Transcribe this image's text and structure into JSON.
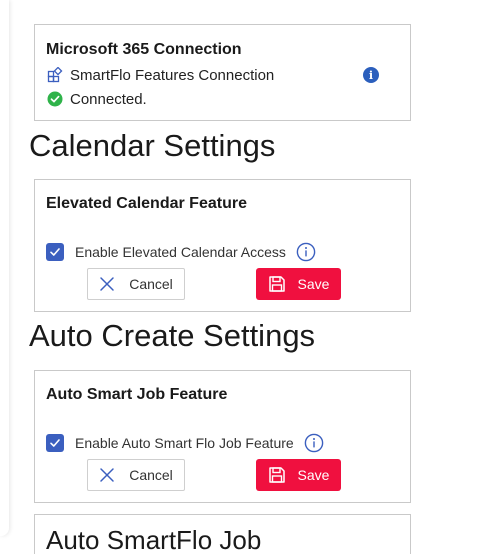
{
  "connection": {
    "title": "Microsoft 365 Connection",
    "features_label": "SmartFlo Features Connection",
    "status": "Connected.",
    "info_icon": "i"
  },
  "calendar": {
    "heading": "Calendar Settings",
    "card_title": "Elevated Calendar Feature",
    "checkbox_label": "Enable Elevated Calendar Access",
    "checked": true,
    "cancel_label": "Cancel",
    "save_label": "Save"
  },
  "autocreate": {
    "heading": "Auto Create Settings",
    "card_title": "Auto Smart Job Feature",
    "checkbox_label": "Enable Auto Smart Flo Job Feature",
    "checked": true,
    "cancel_label": "Cancel",
    "save_label": "Save"
  },
  "next_section": {
    "heading": "Auto SmartFlo Job"
  },
  "colors": {
    "accent_blue": "#3b5fbf",
    "save_red": "#f0103f",
    "connected_green": "#2fb34a"
  }
}
